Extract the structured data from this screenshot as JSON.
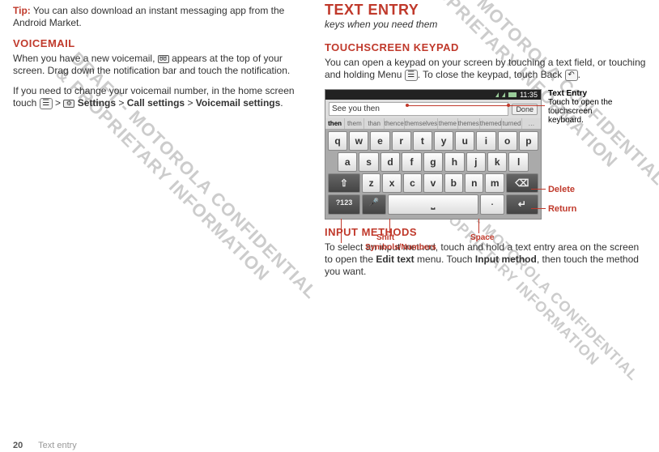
{
  "left": {
    "tipLabel": "Tip:",
    "tipText": " You can also download an instant messaging app from the Android Market.",
    "voicemailHeading": "VOICEMAIL",
    "voicemailP1a": "When you have a new voicemail, ",
    "voicemailIcon": "voicemail-icon",
    "voicemailP1b": " appears at the top of your screen. Drag down the notification bar and touch the notification.",
    "voicemailP2a": "If you need to change your voicemail number, in the home screen touch ",
    "menuIconLabel": "☰",
    "sep": " > ",
    "settingsIcon": "⚙",
    "settingsLabel": " Settings",
    "callSettings": "Call settings",
    "voicemailSettings": "Voicemail settings",
    "period": "."
  },
  "right": {
    "h1": "TEXT ENTRY",
    "subtitle": "keys when you need them",
    "touchHeading": "TOUCHSCREEN KEYPAD",
    "touchP1a": "You can open a keypad on your screen by touching a text field, or touching and holding Menu ",
    "touchP1b": ". To close the keypad, touch Back ",
    "touchP1c": ".",
    "backIcon": "↶",
    "inputHeading": "INPUT METHODS",
    "inputP1a": "To select an input method, touch and hold a text entry area on the screen to open the ",
    "editText": "Edit text",
    "inputP1b": " menu. Touch ",
    "inputMethod": "Input method",
    "inputP1c": ", then touch the method you want."
  },
  "diagram": {
    "time": "11:35",
    "textField": "See you then",
    "done": "Done",
    "suggestions": [
      "then",
      "them",
      "than",
      "thence",
      "themselves",
      "theme",
      "themes",
      "themed",
      "turned",
      "…"
    ],
    "row1": [
      "q",
      "w",
      "e",
      "r",
      "t",
      "y",
      "u",
      "i",
      "o",
      "p"
    ],
    "row2": [
      "a",
      "s",
      "d",
      "f",
      "g",
      "h",
      "j",
      "k",
      "l"
    ],
    "row3Shift": "⇧",
    "row3": [
      "z",
      "x",
      "c",
      "v",
      "b",
      "n",
      "m"
    ],
    "row3Del": "⌫",
    "row4Sym": "?123",
    "row4Mic": "🎤",
    "row4Dot": ".",
    "row4Ret": "↵",
    "callouts": {
      "textEntryTitle": "Text Entry",
      "textEntrySub": "Touch to open the touchscreen keyboard.",
      "delete": "Delete",
      "ret": "Return",
      "shift": "Shift",
      "space": "Space",
      "sym": "Symbols/Numbers"
    }
  },
  "footer": {
    "page": "20",
    "section": "Text entry"
  },
  "watermark": "DRAFT - MOTOROLA CONFIDENTIAL\n& PROPRIETARY INFORMATION"
}
